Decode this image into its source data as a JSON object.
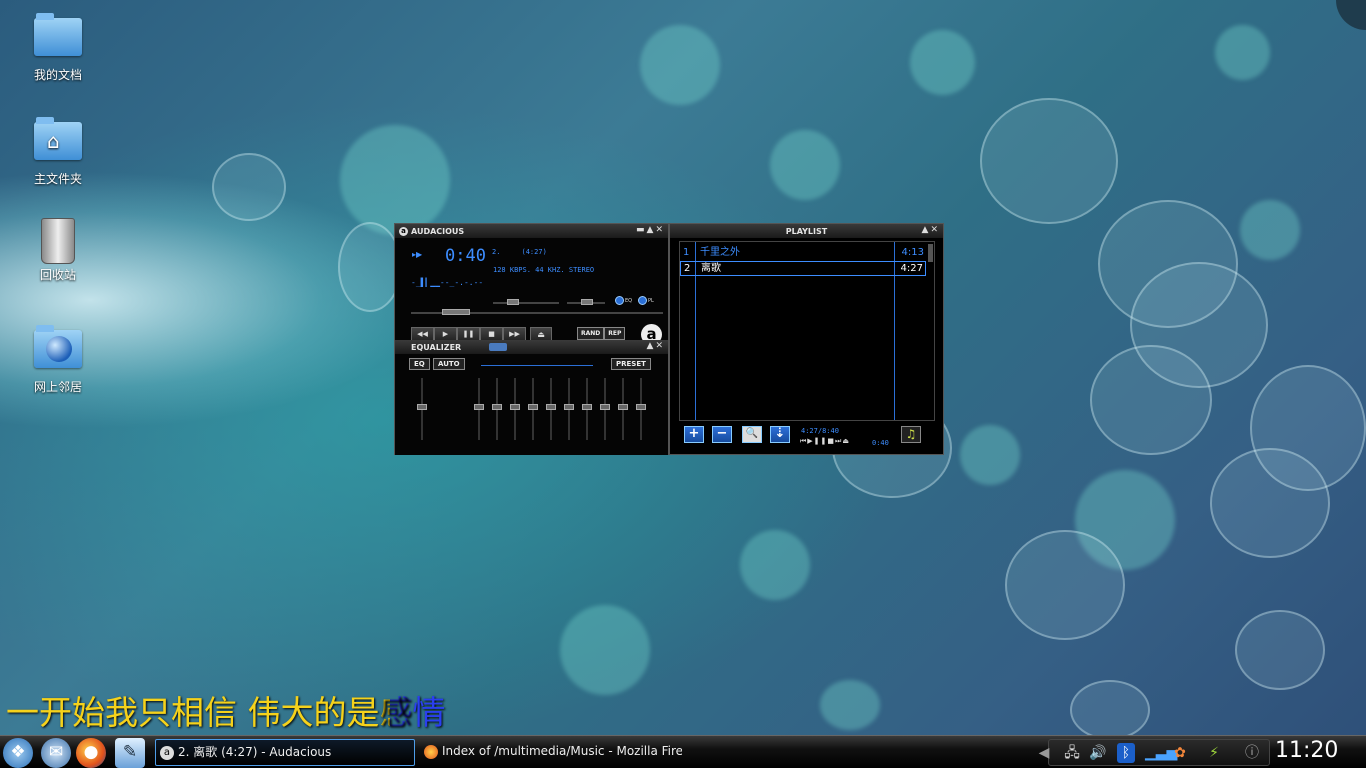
{
  "desktop": {
    "icons": [
      {
        "label": "我的文档"
      },
      {
        "label": "主文件夹"
      },
      {
        "label": "回收站"
      },
      {
        "label": "网上邻居"
      }
    ]
  },
  "audacious": {
    "title": "AUDACIOUS",
    "time": "0:40",
    "track_title": "2.     (4:27)",
    "bitrate_info": "128 KBPS. 44 KHZ. STEREO",
    "eq_toggle": "EQ",
    "pl_toggle": "PL",
    "transport": [
      "◀◀",
      "▶",
      "❚❚",
      "■",
      "▶▶"
    ],
    "eject": "⏏",
    "rand": "RAND",
    "rep": "REP",
    "logo": "a",
    "equalizer": {
      "title": "EQUALIZER",
      "eq_button": "EQ",
      "auto_button": "AUTO",
      "preset_button": "PRESET"
    }
  },
  "playlist": {
    "title": "PLAYLIST",
    "items": [
      {
        "num": "1",
        "title": "千里之外",
        "duration": "4:13"
      },
      {
        "num": "2",
        "title": "离歌",
        "duration": "4:27"
      }
    ],
    "info": "4:27/8:40",
    "time": "0:40",
    "buttons": [
      "+",
      "−",
      "🔍",
      "⇣"
    ]
  },
  "lyric": {
    "sung": "一开始我只相信 伟大的是",
    "partial": "感",
    "rest": "情"
  },
  "taskbar": {
    "tasks": [
      {
        "label": "2. 离歌 (4:27) - Audacious"
      },
      {
        "label": "Index of /multimedia/Music - Mozilla Firefox"
      }
    ],
    "clock": "11:20"
  }
}
